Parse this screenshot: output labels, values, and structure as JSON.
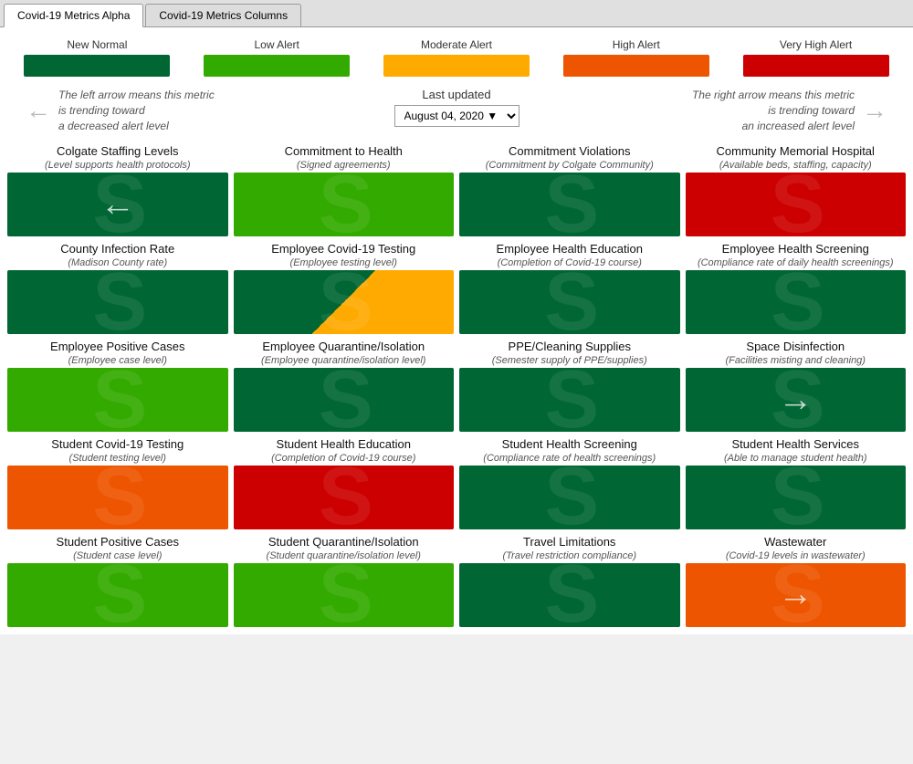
{
  "tabs": [
    {
      "id": "tab-alpha",
      "label": "Covid-19 Metrics Alpha",
      "active": true
    },
    {
      "id": "tab-columns",
      "label": "Covid-19 Metrics Columns",
      "active": false
    }
  ],
  "legend": {
    "items": [
      {
        "id": "new-normal",
        "label": "New Normal",
        "colorClass": "c-new-normal"
      },
      {
        "id": "low-alert",
        "label": "Low Alert",
        "colorClass": "c-low-alert"
      },
      {
        "id": "moderate-alert",
        "label": "Moderate Alert",
        "colorClass": "c-moderate-alert"
      },
      {
        "id": "high-alert",
        "label": "High Alert",
        "colorClass": "c-high-alert"
      },
      {
        "id": "very-high-alert",
        "label": "Very High Alert",
        "colorClass": "c-very-high-alert"
      }
    ]
  },
  "arrows": {
    "left_text": "The left arrow means this metric\nis trending toward\na decreased alert level",
    "right_text": "The right arrow means this metric\nis trending toward\nan increased alert level",
    "last_updated_label": "Last updated",
    "date_value": "August 04, 2020"
  },
  "metrics": [
    {
      "id": "colgate-staffing",
      "title": "Colgate Staffing Levels",
      "subtitle": "(Level supports health protocols)",
      "colorClass": "c-new-normal",
      "arrow": "left"
    },
    {
      "id": "commitment-health",
      "title": "Commitment to Health",
      "subtitle": "(Signed agreements)",
      "colorClass": "c-low-alert",
      "arrow": ""
    },
    {
      "id": "commitment-violations",
      "title": "Commitment Violations",
      "subtitle": "(Commitment by Colgate Community)",
      "colorClass": "c-new-normal",
      "arrow": ""
    },
    {
      "id": "community-memorial",
      "title": "Community Memorial Hospital",
      "subtitle": "(Available beds, staffing, capacity)",
      "colorClass": "c-very-high-alert",
      "arrow": ""
    },
    {
      "id": "county-infection",
      "title": "County Infection Rate",
      "subtitle": "(Madison County rate)",
      "colorClass": "c-new-normal",
      "arrow": ""
    },
    {
      "id": "employee-covid-testing",
      "title": "Employee Covid-19 Testing",
      "subtitle": "(Employee testing level)",
      "colorClass": "c-diagonal",
      "arrow": ""
    },
    {
      "id": "employee-health-education",
      "title": "Employee Health Education",
      "subtitle": "(Completion of Covid-19 course)",
      "colorClass": "c-new-normal",
      "arrow": ""
    },
    {
      "id": "employee-health-screening",
      "title": "Employee Health Screening",
      "subtitle": "(Compliance rate of daily health screenings)",
      "colorClass": "c-new-normal",
      "arrow": ""
    },
    {
      "id": "employee-positive",
      "title": "Employee Positive Cases",
      "subtitle": "(Employee case level)",
      "colorClass": "c-low-alert",
      "arrow": ""
    },
    {
      "id": "employee-quarantine",
      "title": "Employee Quarantine/Isolation",
      "subtitle": "(Employee quarantine/isolation level)",
      "colorClass": "c-new-normal",
      "arrow": ""
    },
    {
      "id": "ppe-cleaning",
      "title": "PPE/Cleaning Supplies",
      "subtitle": "(Semester supply of PPE/supplies)",
      "colorClass": "c-new-normal",
      "arrow": ""
    },
    {
      "id": "space-disinfection",
      "title": "Space Disinfection",
      "subtitle": "(Facilities misting and cleaning)",
      "colorClass": "c-new-normal",
      "arrow": "right"
    },
    {
      "id": "student-covid-testing",
      "title": "Student Covid-19 Testing",
      "subtitle": "(Student testing level)",
      "colorClass": "c-high-alert",
      "arrow": ""
    },
    {
      "id": "student-health-education",
      "title": "Student Health Education",
      "subtitle": "(Completion of Covid-19 course)",
      "colorClass": "c-very-high-alert",
      "arrow": ""
    },
    {
      "id": "student-health-screening",
      "title": "Student Health Screening",
      "subtitle": "(Compliance rate of health screenings)",
      "colorClass": "c-new-normal",
      "arrow": ""
    },
    {
      "id": "student-health-services",
      "title": "Student Health Services",
      "subtitle": "(Able to manage student health)",
      "colorClass": "c-new-normal",
      "arrow": ""
    },
    {
      "id": "student-positive",
      "title": "Student Positive Cases",
      "subtitle": "(Student case level)",
      "colorClass": "c-low-alert",
      "arrow": ""
    },
    {
      "id": "student-quarantine",
      "title": "Student Quarantine/Isolation",
      "subtitle": "(Student quarantine/isolation level)",
      "colorClass": "c-low-alert",
      "arrow": ""
    },
    {
      "id": "travel-limitations",
      "title": "Travel Limitations",
      "subtitle": "(Travel restriction compliance)",
      "colorClass": "c-new-normal",
      "arrow": ""
    },
    {
      "id": "wastewater",
      "title": "Wastewater",
      "subtitle": "(Covid-19 levels in wastewater)",
      "colorClass": "c-high-alert",
      "arrow": "right"
    }
  ]
}
